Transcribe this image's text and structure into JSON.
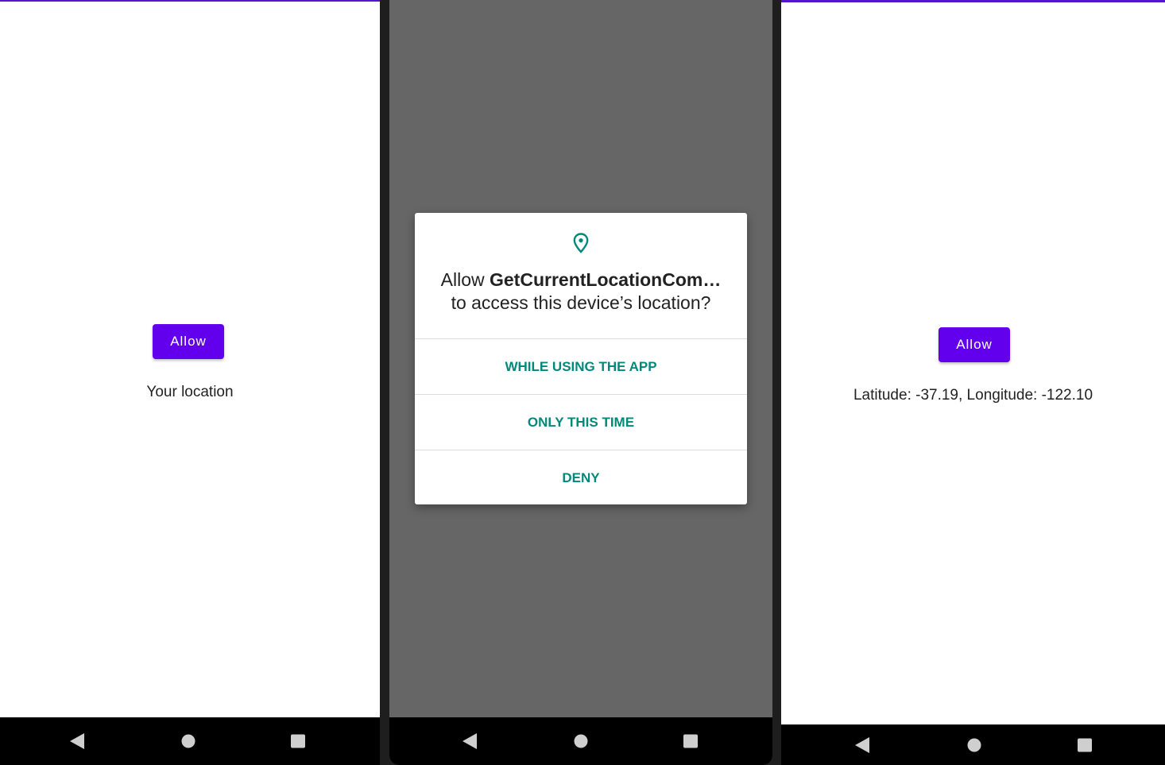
{
  "screens": [
    {
      "id": "before",
      "allow_button_label": "Allow",
      "location_text": "Your location"
    },
    {
      "id": "permission-dialog",
      "dialog": {
        "icon": "location-pin-icon",
        "title_prefix": "Allow ",
        "app_name": "GetCurrentLocationCom…",
        "title_suffix": "to access this device’s location?",
        "options": [
          "WHILE USING THE APP",
          "ONLY THIS TIME",
          "DENY"
        ]
      }
    },
    {
      "id": "after",
      "allow_button_label": "Allow",
      "location_text": "Latitude: -37.19, Longitude: -122.10"
    }
  ],
  "colors": {
    "primary": "#6200ee",
    "status_bar": "#5316cc",
    "dialog_accent": "#00897b",
    "scrim": "#666666",
    "navbar": "#000000"
  },
  "navbar_icons": [
    "back-icon",
    "home-icon",
    "recents-icon"
  ]
}
